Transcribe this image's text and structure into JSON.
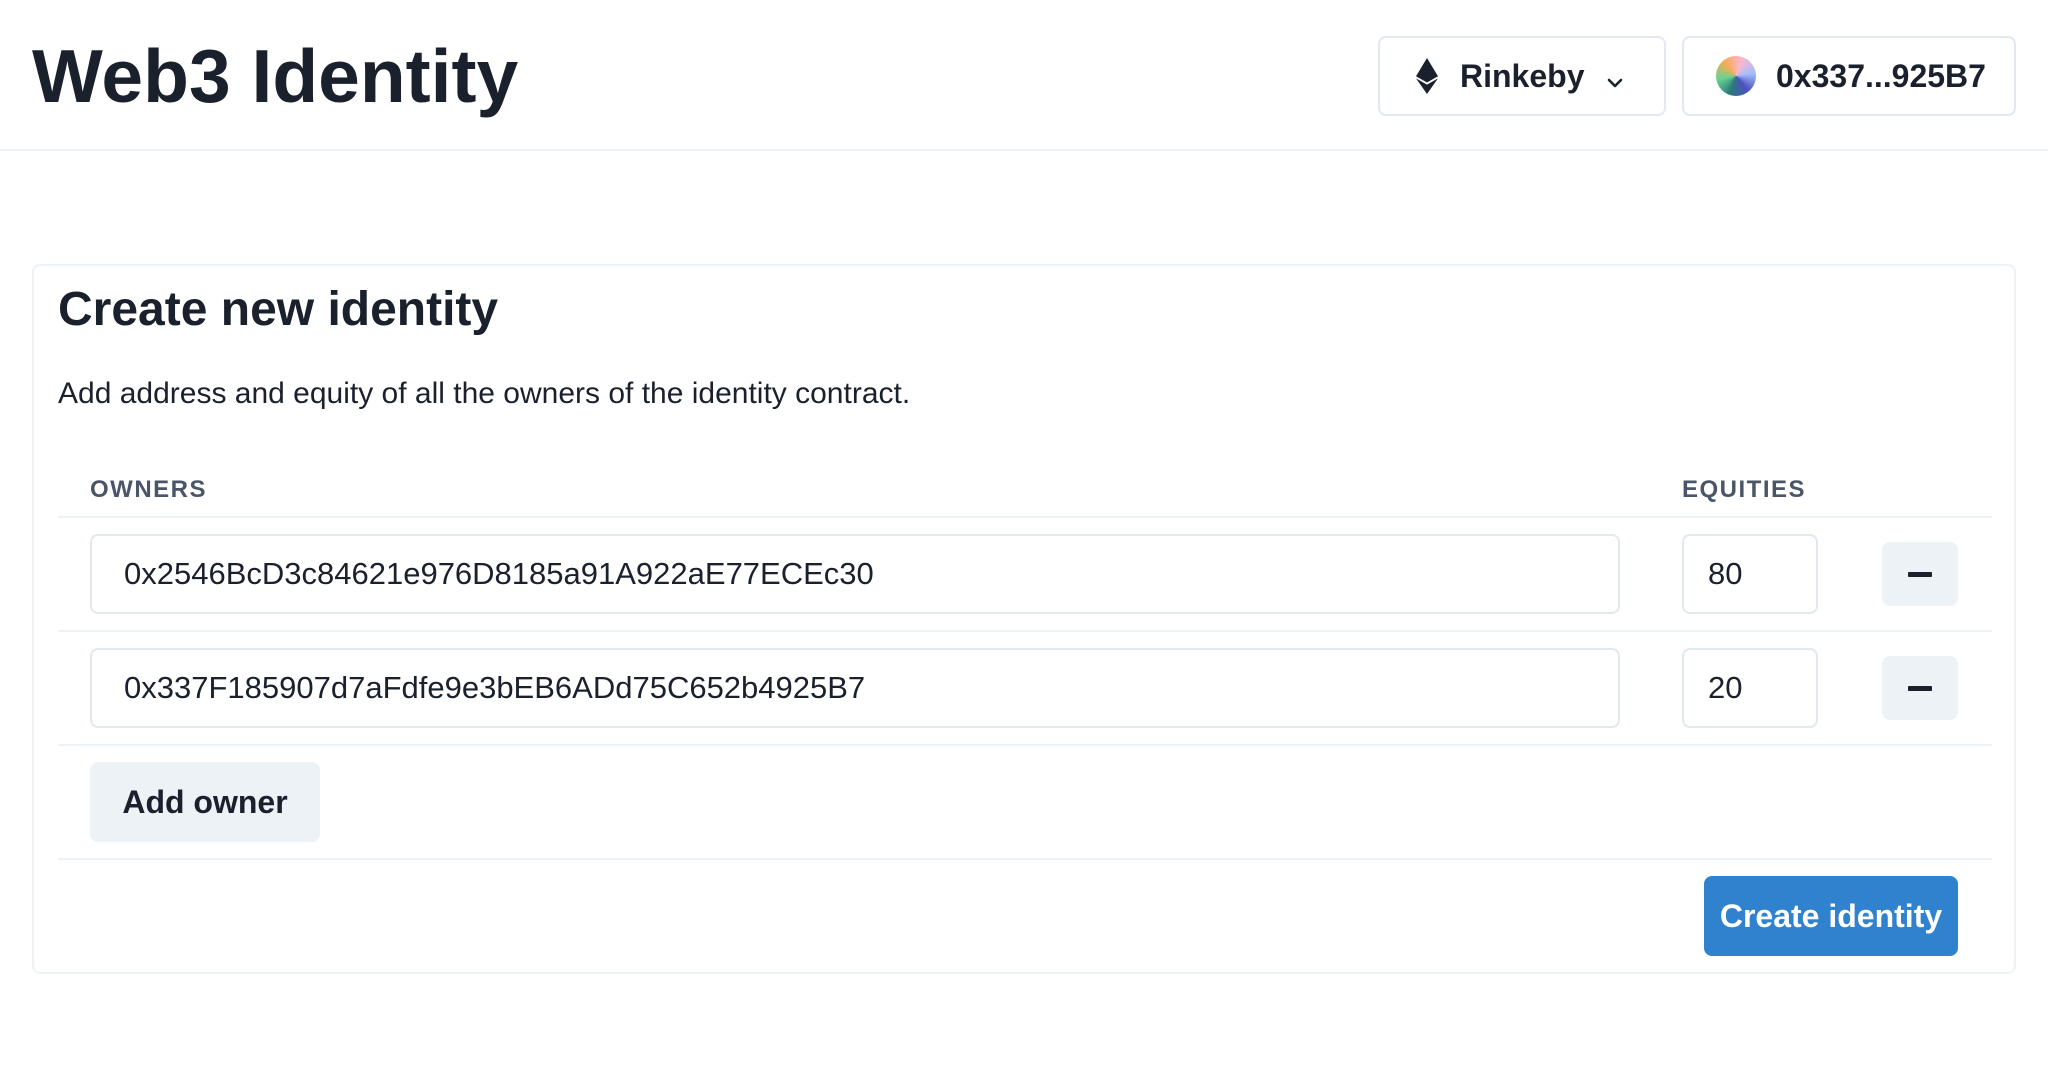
{
  "header": {
    "title": "Web3 Identity",
    "network": {
      "label": "Rinkeby",
      "icon": "ethereum-icon",
      "dropdown_icon": "chevron-down-icon"
    },
    "account": {
      "label": "0x337...925B7",
      "icon": "avatar"
    }
  },
  "card": {
    "title": "Create new identity",
    "description": "Add address and equity of all the owners of the identity contract.",
    "columns": {
      "owners": "OWNERS",
      "equities": "EQUITIES"
    },
    "rows": [
      {
        "address": "0x2546BcD3c84621e976D8185a91A922aE77ECEc30",
        "equity": "80"
      },
      {
        "address": "0x337F185907d7aFdfe9e3bEB6ADd75C652b4925B7",
        "equity": "20"
      }
    ],
    "add_owner_label": "Add owner",
    "create_label": "Create identity"
  },
  "colors": {
    "primary": "#3182ce",
    "text": "#1a202c",
    "muted": "#4a5568",
    "button_bg": "#edf2f7",
    "border": "#e2e8f0"
  }
}
